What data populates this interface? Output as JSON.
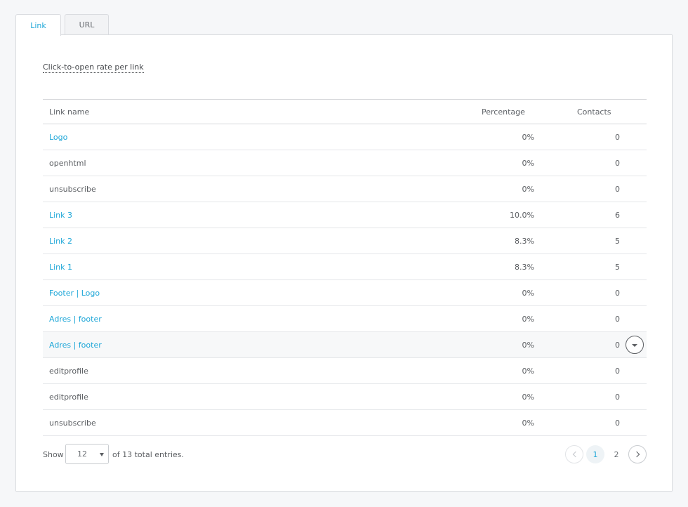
{
  "tabs": [
    {
      "label": "Link",
      "active": true
    },
    {
      "label": "URL",
      "active": false
    }
  ],
  "panel": {
    "title": "Click-to-open rate per link"
  },
  "table": {
    "columns": {
      "name": "Link name",
      "percentage": "Percentage",
      "contacts": "Contacts"
    },
    "rows": [
      {
        "name": "Logo",
        "percentage": "0%",
        "contacts": "0",
        "is_link": true
      },
      {
        "name": "openhtml",
        "percentage": "0%",
        "contacts": "0",
        "is_link": false
      },
      {
        "name": "unsubscribe",
        "percentage": "0%",
        "contacts": "0",
        "is_link": false
      },
      {
        "name": "Link 3",
        "percentage": "10.0%",
        "contacts": "6",
        "is_link": true
      },
      {
        "name": "Link 2",
        "percentage": "8.3%",
        "contacts": "5",
        "is_link": true
      },
      {
        "name": "Link 1",
        "percentage": "8.3%",
        "contacts": "5",
        "is_link": true
      },
      {
        "name": "Footer | Logo",
        "percentage": "0%",
        "contacts": "0",
        "is_link": true
      },
      {
        "name": "Adres | footer",
        "percentage": "0%",
        "contacts": "0",
        "is_link": true
      },
      {
        "name": "Adres | footer",
        "percentage": "0%",
        "contacts": "0",
        "is_link": true,
        "hovered": true
      },
      {
        "name": "editprofile",
        "percentage": "0%",
        "contacts": "0",
        "is_link": false
      },
      {
        "name": "editprofile",
        "percentage": "0%",
        "contacts": "0",
        "is_link": false
      },
      {
        "name": "unsubscribe",
        "percentage": "0%",
        "contacts": "0",
        "is_link": false
      }
    ]
  },
  "footer": {
    "show_label": "Show",
    "page_size": "12",
    "total_label": "of 13 total entries."
  },
  "pagination": {
    "pages": [
      "1",
      "2"
    ],
    "current": "1"
  },
  "colors": {
    "accent": "#1fa7d8",
    "text": "#5b5e62",
    "border": "#d9dbdf",
    "background": "#f6f7f9"
  },
  "icons": {
    "row_toggle": "chevron-down-icon",
    "prev": "chevron-left-icon",
    "next": "chevron-right-icon",
    "select_caret": "caret-down-icon"
  }
}
